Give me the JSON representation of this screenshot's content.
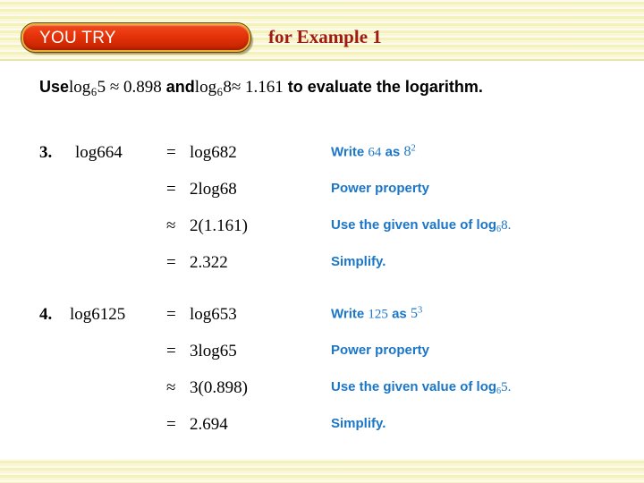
{
  "header": {
    "badge_label": "YOU TRY",
    "example_label": "for Example 1",
    "badge_color": "#e03208",
    "badge_border_color": "#e8b23a",
    "example_text_color": "#a01a12",
    "band_color": "#f7f4c8"
  },
  "instruction": {
    "lead": "Use",
    "expr1_log": "log",
    "expr1_base": "6",
    "expr1_arg": "5",
    "expr1_rel": "≈",
    "expr1_value": "0.898",
    "conj": "and",
    "expr2_log": "log",
    "expr2_base": "6",
    "expr2_arg": "8",
    "expr2_rel": "≈",
    "expr2_value": "1.161",
    "tail": "to evaluate the logarithm."
  },
  "note_color": "#1b76c8",
  "problems": [
    {
      "number": "3.",
      "lhs_log": "log",
      "lhs_base": "6",
      "lhs_arg": "64",
      "rows": [
        {
          "relation": "=",
          "expr_log": "log",
          "expr_base": "6",
          "expr_arg": "8",
          "expr_exp": "2",
          "expr_coeff": "",
          "expr_plain": "",
          "note_lead": "Write",
          "note_value": "64",
          "note_mid": "as",
          "note_value2": "8",
          "note_value2_exp": "2",
          "note_tail": ""
        },
        {
          "relation": "=",
          "expr_log": "log",
          "expr_base": "6",
          "expr_arg": "8",
          "expr_exp": "",
          "expr_coeff": "2",
          "expr_plain": "",
          "note_lead": "Power property",
          "note_value": "",
          "note_mid": "",
          "note_value2": "",
          "note_value2_exp": "",
          "note_tail": ""
        },
        {
          "relation": "≈",
          "expr_log": "",
          "expr_base": "",
          "expr_arg": "",
          "expr_exp": "",
          "expr_coeff": "",
          "expr_plain": "2(1.161)",
          "note_lead": "Use the given value of log",
          "note_value": "",
          "note_mid": "",
          "note_value2": "",
          "note_value2_exp": "",
          "note_sub": "6",
          "note_tail": "8."
        },
        {
          "relation": "=",
          "expr_log": "",
          "expr_base": "",
          "expr_arg": "",
          "expr_exp": "",
          "expr_coeff": "",
          "expr_plain": "2.322",
          "note_lead": "Simplify.",
          "note_value": "",
          "note_mid": "",
          "note_value2": "",
          "note_value2_exp": "",
          "note_tail": ""
        }
      ]
    },
    {
      "number": "4.",
      "lhs_log": "log",
      "lhs_base": "6",
      "lhs_arg": "125",
      "rows": [
        {
          "relation": "=",
          "expr_log": "log",
          "expr_base": "6",
          "expr_arg": "5",
          "expr_exp": "3",
          "expr_coeff": "",
          "expr_plain": "",
          "note_lead": "Write",
          "note_value": "125",
          "note_mid": "as",
          "note_value2": "5",
          "note_value2_exp": "3",
          "note_tail": ""
        },
        {
          "relation": "=",
          "expr_log": "log",
          "expr_base": "6",
          "expr_arg": "5",
          "expr_exp": "",
          "expr_coeff": "3",
          "expr_plain": "",
          "note_lead": "Power property",
          "note_value": "",
          "note_mid": "",
          "note_value2": "",
          "note_value2_exp": "",
          "note_tail": ""
        },
        {
          "relation": "≈",
          "expr_log": "",
          "expr_base": "",
          "expr_arg": "",
          "expr_exp": "",
          "expr_coeff": "",
          "expr_plain": "3(0.898)",
          "note_lead": "Use the given value of log",
          "note_value": "",
          "note_mid": "",
          "note_value2": "",
          "note_value2_exp": "",
          "note_sub": "6",
          "note_tail": "5."
        },
        {
          "relation": "=",
          "expr_log": "",
          "expr_base": "",
          "expr_arg": "",
          "expr_exp": "",
          "expr_coeff": "",
          "expr_plain": "2.694",
          "note_lead": "Simplify.",
          "note_value": "",
          "note_mid": "",
          "note_value2": "",
          "note_value2_exp": "",
          "note_tail": ""
        }
      ]
    }
  ]
}
